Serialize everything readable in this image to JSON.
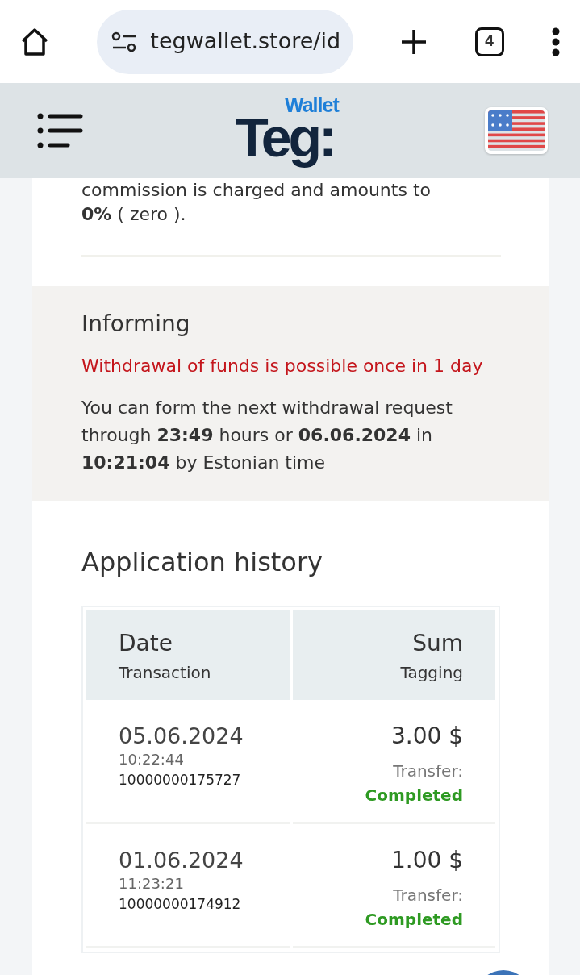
{
  "browser": {
    "url": "tegwallet.store/id",
    "tab_count": "4"
  },
  "header": {
    "logo_main": "Teg:",
    "logo_sup": "Wallet"
  },
  "intro": {
    "cut_line": "commission is charged and amounts to",
    "text": "**0%** ( zero )."
  },
  "informing": {
    "title": "Informing",
    "warning": "Withdrawal of funds is possible once in 1 day",
    "text": "You can form the next withdrawal request through **23:49** hours or **06.06.2024** in **10:21:04** by Estonian time"
  },
  "history": {
    "title": "Application history",
    "columns": [
      {
        "title": "Date",
        "subtitle": "Transaction"
      },
      {
        "title": "Sum",
        "subtitle": "Tagging"
      }
    ],
    "rows": [
      {
        "date": "05.06.2024",
        "time": "10:22:44",
        "id": "10000000175727",
        "sum": "3.00 $",
        "label": "Transfer:",
        "status": "Completed"
      },
      {
        "date": "01.06.2024",
        "time": "11:23:21",
        "id": "10000000174912",
        "sum": "1.00 $",
        "label": "Transfer:",
        "status": "Completed"
      }
    ]
  }
}
